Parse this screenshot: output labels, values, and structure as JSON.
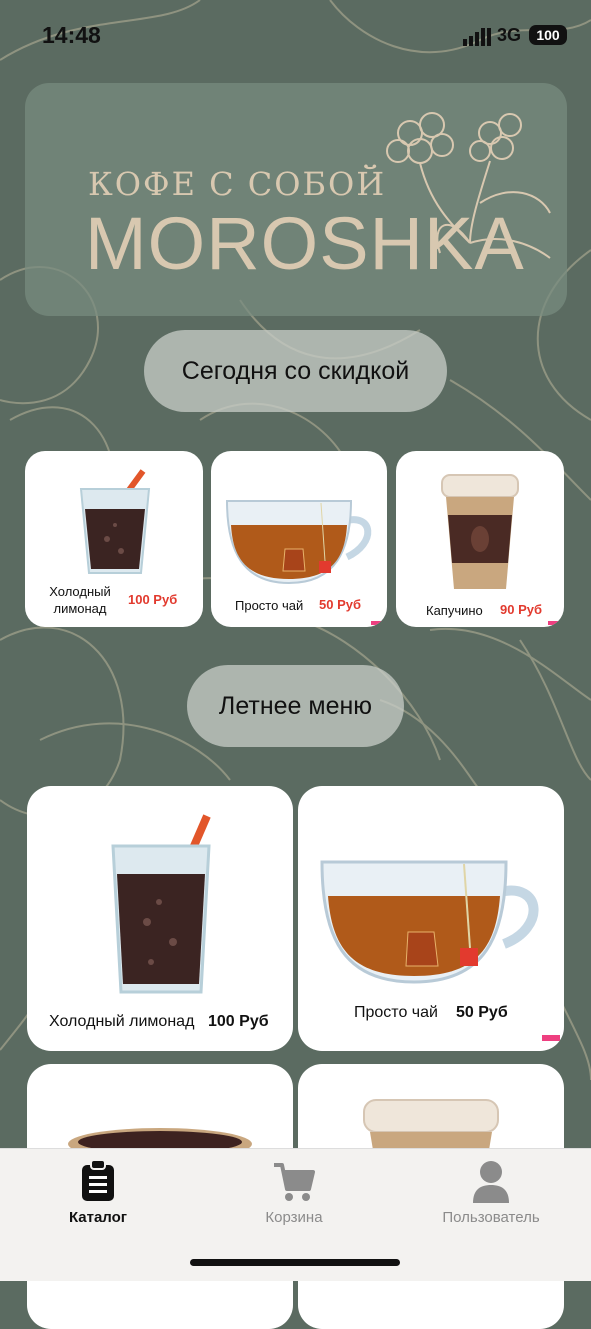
{
  "status": {
    "time": "14:48",
    "network": "3G",
    "battery": "100"
  },
  "banner": {
    "tagline": "КОФЕ С СОБОЙ",
    "brand": "MOROSHKA"
  },
  "sections": {
    "discount_title": "Сегодня со скидкой",
    "summer_title": "Летнее меню"
  },
  "discount_items": [
    {
      "name": "Холодный лимонад",
      "price": "100 Руб"
    },
    {
      "name": "Просто чай",
      "price": "50 Руб"
    },
    {
      "name": "Капучино",
      "price": "90 Руб"
    }
  ],
  "summer_items": [
    {
      "name": "Холодный лимонад",
      "price": "100 Руб"
    },
    {
      "name": "Просто чай",
      "price": "50 Руб"
    }
  ],
  "tabs": [
    {
      "label": "Каталог",
      "active": true,
      "icon": "clipboard-icon"
    },
    {
      "label": "Корзина",
      "active": false,
      "icon": "cart-icon"
    },
    {
      "label": "Пользователь",
      "active": false,
      "icon": "user-icon"
    }
  ],
  "colors": {
    "background": "#5b6b61",
    "price_red": "#e23a2e",
    "banner_text": "#d8c8b0"
  }
}
